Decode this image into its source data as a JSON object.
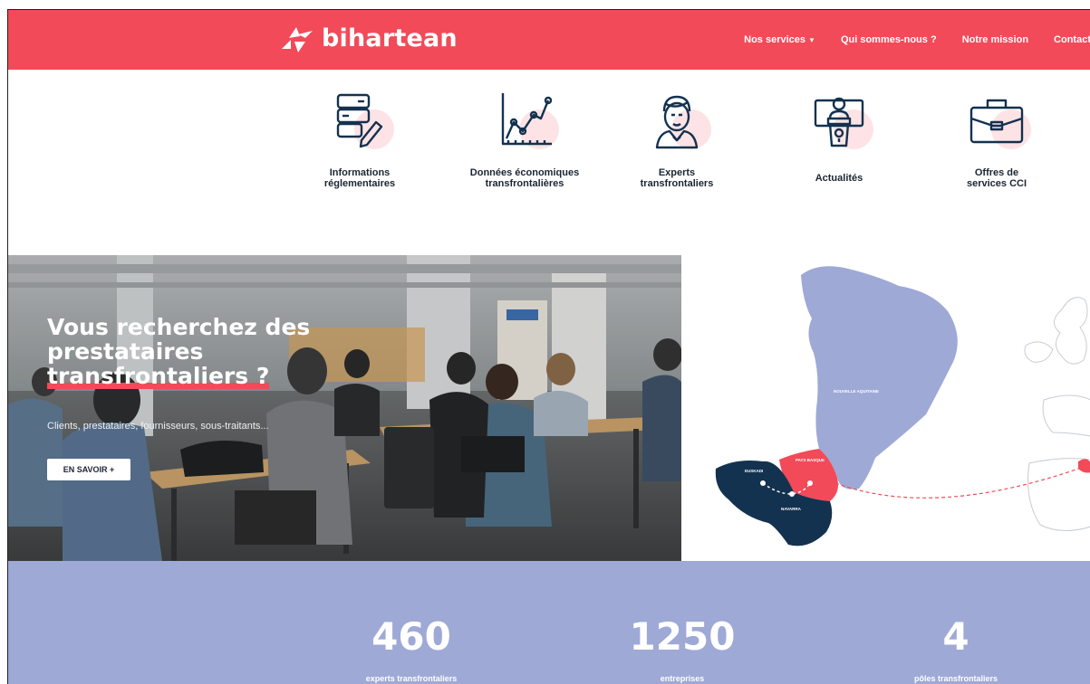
{
  "header": {
    "brand": "bihartean",
    "nav": [
      {
        "label": "Nos services"
      },
      {
        "label": "Qui sommes-nous ?"
      },
      {
        "label": "Notre mission"
      },
      {
        "label": "Contact"
      }
    ]
  },
  "services": [
    {
      "label_line1": "Informations",
      "label_line2": "réglementaires",
      "icon": "server-pencil-icon"
    },
    {
      "label_line1": "Données économiques",
      "label_line2": "transfrontalières",
      "icon": "line-chart-icon"
    },
    {
      "label_line1": "Experts",
      "label_line2": "transfrontaliers",
      "icon": "expert-avatar-icon"
    },
    {
      "label_line1": "Actualités",
      "label_line2": "",
      "icon": "speaker-podium-icon"
    },
    {
      "label_line1": "Offres de",
      "label_line2": "services CCI",
      "icon": "briefcase-icon"
    }
  ],
  "hero": {
    "title_line1": "Vous recherchez des",
    "title_line2": "prestataires",
    "title_line3": "transfrontaliers ?",
    "subtitle": "Clients, prestataires, fournisseurs, sous-traitants...",
    "cta": "EN SAVOIR +"
  },
  "map": {
    "labels": {
      "nouvelle_aquitaine": "NOUVELLE AQUITAINE",
      "pays_basque": "PAYS BASQUE",
      "euskadi": "EUSKADI",
      "navarra": "NAVARRA"
    }
  },
  "stats": [
    {
      "value": "460",
      "caption": "experts transfrontaliers"
    },
    {
      "value": "1250",
      "caption": "entreprises"
    },
    {
      "value": "4",
      "caption": "pôles transfrontaliers"
    }
  ],
  "colors": {
    "brand_red": "#f24a59",
    "navy": "#13324f",
    "lavender": "#9ea9d6"
  }
}
